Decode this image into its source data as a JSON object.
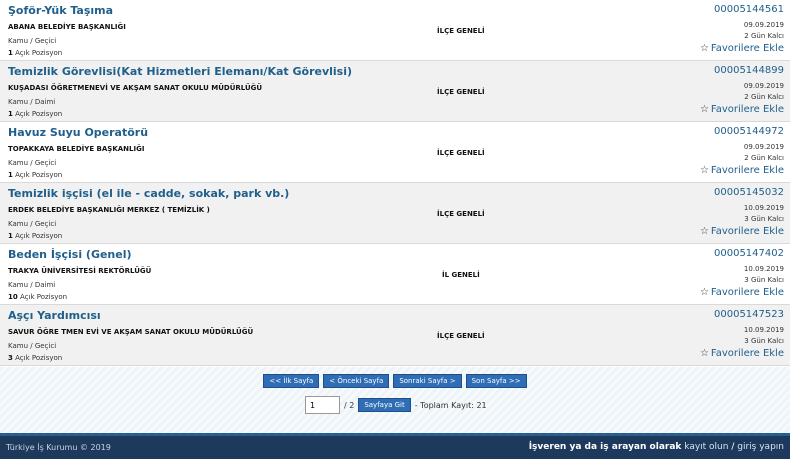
{
  "listings": [
    {
      "title": "Şoför-Yük Taşıma",
      "org": "ABANA BELEDİYE BAŞKANLIĞI",
      "type": "Kamu / Geçici",
      "positions_count": "1",
      "positions_label": "Açık Pozisyon",
      "scope": "İLÇE GENELİ",
      "ref": "00005144561",
      "date": "09.09.2019",
      "remaining": "2 Gün Kalcı",
      "fav": "Favorilere Ekle"
    },
    {
      "title": "Temizlik Görevlisi(Kat Hizmetleri Elemanı/Kat Görevlisi)",
      "org": "KUŞADASI ÖĞRETMENEVİ VE AKŞAM SANAT OKULU MÜDÜRLÜĞÜ",
      "type": "Kamu / Daimi",
      "positions_count": "1",
      "positions_label": "Açık Pozisyon",
      "scope": "İLÇE GENELİ",
      "ref": "00005144899",
      "date": "09.09.2019",
      "remaining": "2 Gün Kalcı",
      "fav": "Favorilere Ekle"
    },
    {
      "title": "Havuz Suyu Operatörü",
      "org": "TOPAKKAYA BELEDİYE BAŞKANLIĞI",
      "type": "Kamu / Geçici",
      "positions_count": "1",
      "positions_label": "Açık Pozisyon",
      "scope": "İLÇE GENELİ",
      "ref": "00005144972",
      "date": "09.09.2019",
      "remaining": "2 Gün Kalcı",
      "fav": "Favorilere Ekle"
    },
    {
      "title": "Temizlik işçisi (el ile - cadde, sokak, park vb.)",
      "org": "ERDEK BELEDİYE BAŞKANLIĞI MERKEZ ( TEMİZLİK )",
      "type": "Kamu / Geçici",
      "positions_count": "1",
      "positions_label": "Açık Pozisyon",
      "scope": "İLÇE GENELİ",
      "ref": "00005145032",
      "date": "10.09.2019",
      "remaining": "3 Gün Kalcı",
      "fav": "Favorilere Ekle"
    },
    {
      "title": "Beden İşçisi (Genel)",
      "org": "TRAKYA ÜNİVERSİTESİ REKTÖRLÜĞÜ",
      "type": "Kamu / Daimi",
      "positions_count": "10",
      "positions_label": "Açık Pozisyon",
      "scope": "İL GENELİ",
      "ref": "00005147402",
      "date": "10.09.2019",
      "remaining": "3 Gün Kalcı",
      "fav": "Favorilere Ekle"
    },
    {
      "title": "Aşçı Yardımcısı",
      "org": "SAVUR ÖĞRE TMEN EVİ VE AKŞAM SANAT OKULU MÜDÜRLÜĞÜ",
      "type": "Kamu / Geçici",
      "positions_count": "3",
      "positions_label": "Açık Pozisyon",
      "scope": "İLÇE GENELİ",
      "ref": "00005147523",
      "date": "10.09.2019",
      "remaining": "3 Gün Kalcı",
      "fav": "Favorilere Ekle"
    }
  ],
  "pager": {
    "first": "<< İlk Sayfa",
    "prev": "< Önceki Sayfa",
    "next": "Sonraki Sayfa >",
    "last": "Son Sayfa >>",
    "page_value": "1",
    "total_pages": "/ 2",
    "go_button": "Sayfaya Git",
    "total_records": "- Toplam Kayıt: 21"
  },
  "footer": {
    "copyright": "Türkiye İş Kurumu © 2019",
    "cta_bold": "İşveren ya da iş arayan olarak",
    "register": "kayıt olun",
    "separator": "/",
    "login": "giriş yapın"
  },
  "colors": {
    "link_blue": "#1f5f8b",
    "button_blue": "#2f6db5",
    "footer_bg": "#1d3a5c"
  }
}
